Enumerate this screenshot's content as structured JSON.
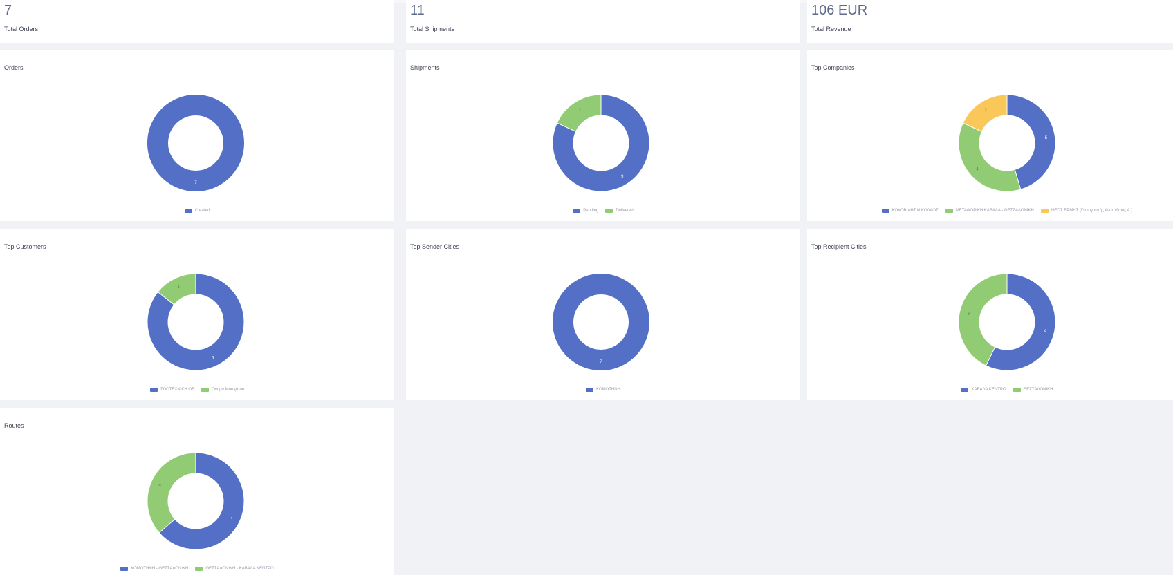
{
  "colors": {
    "blue": "#5470c6",
    "green": "#91cc75",
    "yellow": "#fac858",
    "background": "#f1f2f6",
    "card": "#ffffff"
  },
  "stats": {
    "orders": {
      "value": "7",
      "label": "Total Orders"
    },
    "shipments": {
      "value": "11",
      "label": "Total Shipments"
    },
    "revenue": {
      "value": "106 EUR",
      "label": "Total Revenue"
    }
  },
  "charts": {
    "orders": {
      "title": "Orders"
    },
    "shipments": {
      "title": "Shipments"
    },
    "companies": {
      "title": "Top Companies"
    },
    "customers": {
      "title": "Top Customers"
    },
    "sender_cities": {
      "title": "Top Sender Cities"
    },
    "recipient_cities": {
      "title": "Top Recipient Cities"
    },
    "routes": {
      "title": "Routes"
    }
  },
  "chart_data": [
    {
      "type": "pie",
      "title": "Orders",
      "categories": [
        "Created"
      ],
      "values": [
        7
      ],
      "colors": [
        "#5470c6"
      ],
      "legend": "bottom"
    },
    {
      "type": "pie",
      "title": "Shipments",
      "categories": [
        "Pending",
        "Delivered"
      ],
      "values": [
        9,
        2
      ],
      "colors": [
        "#5470c6",
        "#91cc75"
      ],
      "legend": "bottom"
    },
    {
      "type": "pie",
      "title": "Top Companies",
      "categories": [
        "ΚΟΚΟΒΙΔΗΣ ΝΙΚΟΛΑΟΣ",
        "ΜΕΤΑΦΟΡΙΚΗ ΚΑΒΑΛΑ - ΘΕΣΣΑΛΟΝΙΚΗ",
        "ΝΕΟΣ ΕΡΜΗΣ (Γεωργουλής Αναστάσιος Α.)"
      ],
      "values": [
        5,
        4,
        2
      ],
      "colors": [
        "#5470c6",
        "#91cc75",
        "#fac858"
      ],
      "legend": "bottom"
    },
    {
      "type": "pie",
      "title": "Top Customers",
      "categories": [
        "ΖΩΟΤΕΧΝΙΚΗ ΟΕ",
        "Όνομα Μοσχάτου"
      ],
      "values": [
        6,
        1
      ],
      "colors": [
        "#5470c6",
        "#91cc75"
      ],
      "legend": "bottom"
    },
    {
      "type": "pie",
      "title": "Top Sender Cities",
      "categories": [
        "ΚΟΜΟΤΗΝΗ"
      ],
      "values": [
        7
      ],
      "colors": [
        "#5470c6"
      ],
      "legend": "bottom"
    },
    {
      "type": "pie",
      "title": "Top Recipient Cities",
      "categories": [
        "ΚΑΒΑΛΑ ΚΕΝΤΡΟ",
        "ΘΕΣΣΑΛΟΝΙΚΗ"
      ],
      "values": [
        4,
        3
      ],
      "colors": [
        "#5470c6",
        "#91cc75"
      ],
      "legend": "bottom"
    },
    {
      "type": "pie",
      "title": "Routes",
      "categories": [
        "ΚΟΜΟΤΗΝΗ - ΘΕΣΣΑΛΟΝΙΚΗ",
        "ΘΕΣΣΑΛΟΝΙΚΗ - ΚΑΒΑΛΑ ΚΕΝΤΡΟ"
      ],
      "values": [
        7,
        4
      ],
      "colors": [
        "#5470c6",
        "#91cc75"
      ],
      "legend": "bottom"
    }
  ]
}
